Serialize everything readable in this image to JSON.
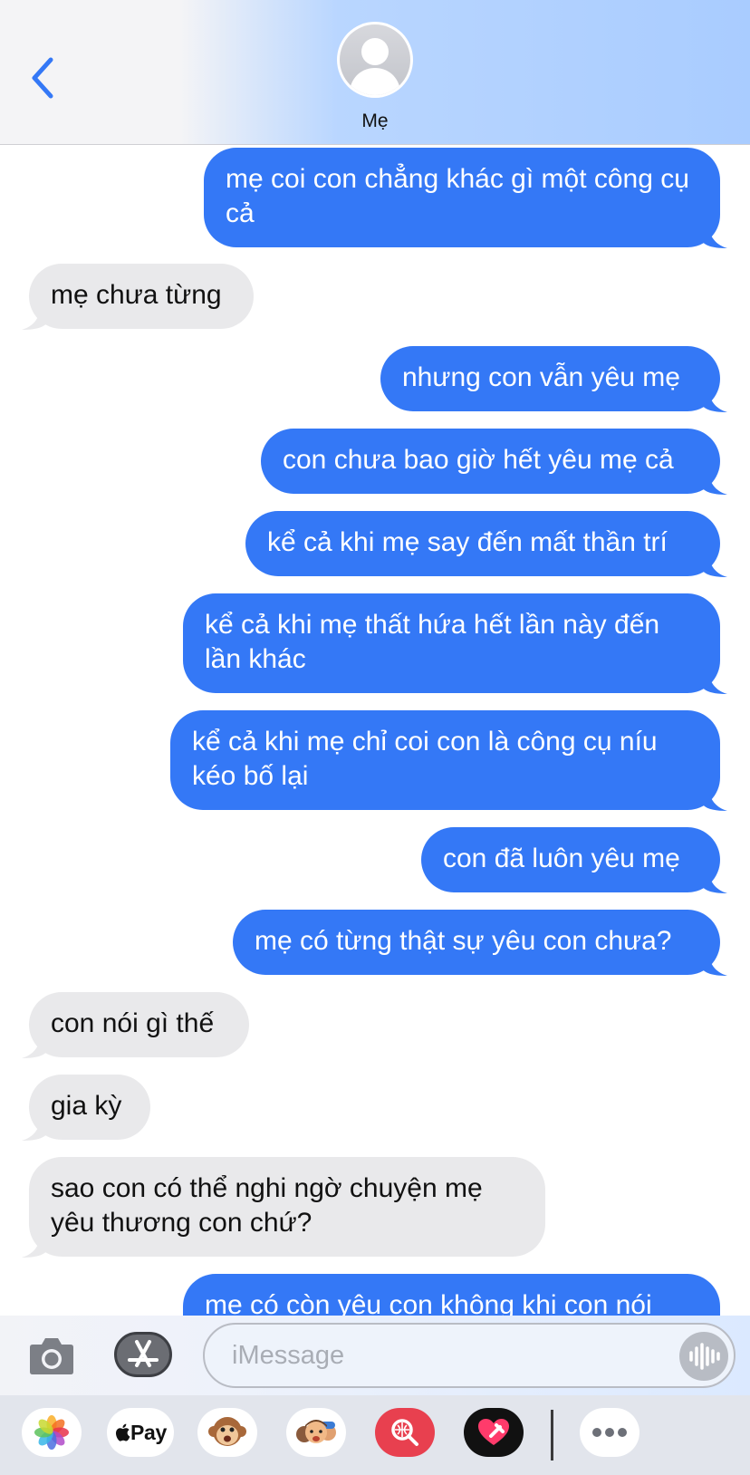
{
  "header": {
    "contact_name": "Mẹ"
  },
  "messages": [
    {
      "side": "out",
      "text": "mẹ coi con chẳng khác gì một công cụ cả"
    },
    {
      "side": "in",
      "text": "mẹ chưa từng"
    },
    {
      "side": "out",
      "text": "nhưng con vẫn yêu mẹ"
    },
    {
      "side": "out",
      "text": "con chưa bao giờ hết yêu mẹ cả"
    },
    {
      "side": "out",
      "text": "kể cả khi mẹ say đến mất thần trí"
    },
    {
      "side": "out",
      "text": "kể cả khi mẹ thất hứa hết lần này đến lần khác"
    },
    {
      "side": "out",
      "text": "kể cả khi mẹ chỉ coi con là công cụ níu kéo bố lại"
    },
    {
      "side": "out",
      "text": "con đã luôn yêu mẹ"
    },
    {
      "side": "out",
      "text": "mẹ có từng thật sự yêu con chưa?"
    },
    {
      "side": "in",
      "text": "con nói gì thế"
    },
    {
      "side": "in",
      "text": "gia kỳ"
    },
    {
      "side": "in",
      "text": "sao con có thể nghi ngờ chuyện mẹ yêu thương con chứ?"
    },
    {
      "side": "out",
      "text": "mẹ có còn yêu con không khi con nói"
    }
  ],
  "input_bar": {
    "placeholder": "iMessage"
  },
  "app_drawer": {
    "apps": [
      "photos-icon",
      "apple-pay",
      "animoji-icon",
      "memoji-icon",
      "image-search-icon",
      "digital-touch-icon",
      "more-icon"
    ],
    "apple_pay_label": "Pay"
  },
  "colors": {
    "outgoing_bubble": "#3478f6",
    "incoming_bubble": "#e9e9eb",
    "accent": "#3478f6"
  }
}
